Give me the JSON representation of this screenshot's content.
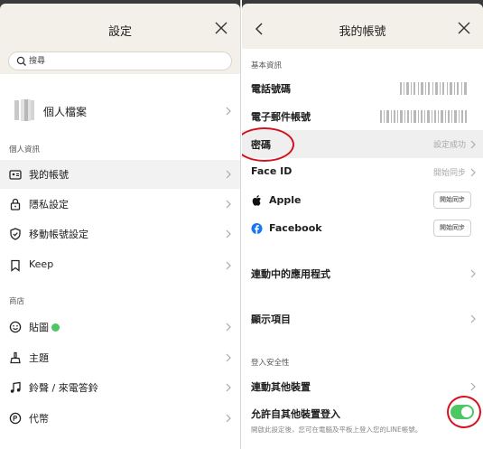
{
  "left": {
    "header": {
      "title": "設定"
    },
    "search": {
      "placeholder": "搜尋"
    },
    "profile": {
      "label": "個人檔案"
    },
    "sections": {
      "personal": "個人資訊",
      "store": "商店"
    },
    "personal_items": [
      {
        "label": "我的帳號",
        "icon": "id-card-icon",
        "highlighted": true
      },
      {
        "label": "隱私設定",
        "icon": "lock-icon"
      },
      {
        "label": "移動帳號設定",
        "icon": "shield-icon"
      },
      {
        "label": "Keep",
        "icon": "bookmark-icon"
      }
    ],
    "store_items": [
      {
        "label": "貼圖",
        "icon": "smile-icon",
        "badge": true
      },
      {
        "label": "主題",
        "icon": "brush-icon"
      },
      {
        "label": "鈴聲 / 來電答鈴",
        "icon": "music-note-icon"
      },
      {
        "label": "代幣",
        "icon": "coin-icon"
      }
    ]
  },
  "right": {
    "header": {
      "title": "我的帳號"
    },
    "sections": {
      "basic": "基本資訊",
      "security": "登入安全性"
    },
    "phone": {
      "label": "電話號碼"
    },
    "email": {
      "label": "電子郵件帳號"
    },
    "password": {
      "label": "密碼",
      "value": "設定成功"
    },
    "faceid": {
      "label": "Face ID",
      "value": "開始同步"
    },
    "apple": {
      "label": "Apple",
      "button": "開始同步"
    },
    "facebook": {
      "label": "Facebook",
      "button": "開始同步"
    },
    "linked_apps": {
      "label": "連動中的應用程式"
    },
    "display_items": {
      "label": "顯示項目"
    },
    "link_devices": {
      "label": "連動其他裝置"
    },
    "allow_login": {
      "label": "允許自其他裝置登入",
      "description": "開啟此設定後，您可在電腦及平板上登入您的LINE帳號。",
      "enabled": true
    }
  },
  "colors": {
    "header_bg": "#f3f0ea",
    "toggle_on": "#4cc764",
    "annotation_red": "#d4101e",
    "facebook_blue": "#1877f2"
  }
}
